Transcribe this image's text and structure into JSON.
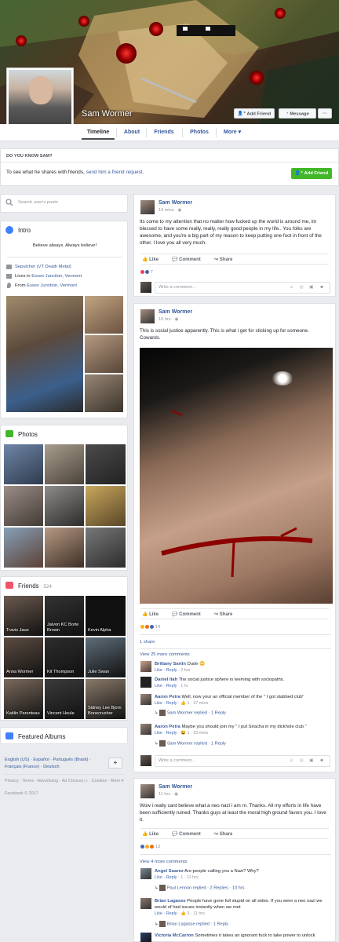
{
  "profile": {
    "name": "Sam Wormer"
  },
  "header": {
    "add_friend": "Add Friend",
    "message": "Message",
    "more_dots": "···"
  },
  "tabs": [
    {
      "label": "Timeline"
    },
    {
      "label": "About"
    },
    {
      "label": "Friends"
    },
    {
      "label": "Photos"
    },
    {
      "label": "More ▾"
    }
  ],
  "know": {
    "title": "DO YOU KNOW SAM?",
    "text": "To see what he shares with friends, ",
    "link": "send him a friend request.",
    "button": "Add Friend"
  },
  "search": {
    "placeholder": "Search user's posts"
  },
  "intro": {
    "title": "Intro",
    "bio": "Believe always. Always believe!",
    "work": "Sepulcher (VT Death Metal)",
    "lives_prefix": "Lives in ",
    "lives": "Essex Junction, Vermont",
    "from_prefix": "From ",
    "from": "Essex Junction, Vermont"
  },
  "photos": {
    "title": "Photos"
  },
  "friends": {
    "title": "Friends",
    "count": "· 524",
    "list": [
      {
        "name": "Travis Jaue"
      },
      {
        "name": "Jaivon KC Borte Brown"
      },
      {
        "name": "Kevin Alpha"
      },
      {
        "name": "Anna Wormer"
      },
      {
        "name": "Kit Thompson"
      },
      {
        "name": "Julie Swan"
      },
      {
        "name": "Kaitlin Parenteau"
      },
      {
        "name": "Vincent Houle"
      },
      {
        "name": "Sidney Lee Bjorn Bonecrusher"
      }
    ]
  },
  "albums": {
    "title": "Featured Albums"
  },
  "languages": {
    "items": "English (US) · Español · Português (Brasil) · Français (France) · Deutsch",
    "add": "+"
  },
  "footer": {
    "links": "Privacy · Terms · Advertising · Ad Choices ▷ · Cookies · More ▾",
    "copyright": "Facebook © 2017"
  },
  "ui": {
    "like": "Like",
    "comment": "Comment",
    "share": "Share",
    "write_comment": "Write a comment..."
  },
  "posts": [
    {
      "name": "Sam Wormer",
      "time": "19 mins · ◉",
      "text": "Its come to my attention that no matter how fucked up the world is around me, im blessed to have some really, really, really good people in my life.. You folks are awesome, and you're a big part of my reason to keep putting one foot in front of the other. I love you all very much.",
      "reactions": "7"
    },
    {
      "name": "Sam Wormer",
      "time": "10 hrs · ◉",
      "text": "This is social justice apparently. This is what i get for sticking up for someone. Cowards.",
      "reactions": "14",
      "shares": "1 share",
      "more_comments": "View 25 more comments",
      "comments": [
        {
          "name": "Brittany Sartin",
          "text": " Dude 😳",
          "meta_like": "Like",
          "meta_reply": "Reply",
          "meta_rest": " · 2 hrs"
        },
        {
          "name": "Daniel Ilah",
          "text": " The social justice sphere is teeming with sociopaths.",
          "meta_like": "Like",
          "meta_reply": "Reply",
          "meta_rest": " · 1 hr"
        },
        {
          "name": "Aaron Petra",
          "text": " Well, now your an official member of the \" I got stabbed club\"",
          "meta_like": "Like",
          "meta_reply": "Reply",
          "meta_rest": " · 👍 1 · 37 mins"
        },
        {
          "name": "Aaron Petra",
          "text": " Maybe you should join my \" I put Siracha in my dickhole club \"",
          "meta_like": "Like",
          "meta_reply": "Reply",
          "meta_rest": " · 😆 1 · 33 mins"
        }
      ],
      "replies": [
        {
          "text": "Sam Wormer replied · 1 Reply"
        },
        {
          "text": "Sam Wormer replied · 1 Reply"
        }
      ]
    },
    {
      "name": "Sam Wormer",
      "time": "11 hrs · ◉",
      "text": "Wow i really cant believe what a neo nazi i am rn. Thanks. All my efforts in life have been sufficiently ruined. Thanks guys at least the moral high ground favors you. I love it.",
      "reactions": "13",
      "more_comments": "View 4 more comments",
      "comments": [
        {
          "name": "Angel Suarez",
          "text": " Are people calling you a Nazi? Why?",
          "meta_like": "Like",
          "meta_reply": "Reply",
          "meta_rest": " · 1 · 11 hrs"
        },
        {
          "name": "Brian Lagasse",
          "text": " People have gone full stupid on all sides. If you were a neo nazi we would of had issues instantly when we met",
          "meta_like": "Like",
          "meta_reply": "Reply",
          "meta_rest": " · 👍 3 · 11 hrs"
        },
        {
          "name": "Victoria McCarron",
          "text": " Sometimes it takes an ignorant fuck to take power to unlock"
        }
      ],
      "replies": [
        {
          "text": "Paul Lennon replied · 2 Replies · 10 hrs"
        },
        {
          "text": "Brian Lagasse replied · 1 Reply"
        }
      ]
    }
  ]
}
